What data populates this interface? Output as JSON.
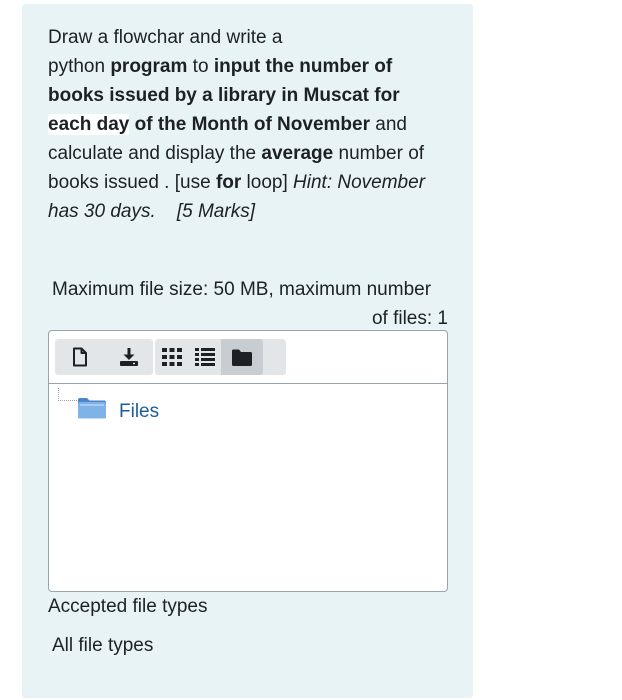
{
  "question": {
    "line1": {
      "t1": "Draw a flowchar and write a"
    },
    "line2": {
      "t1": "python ",
      "b1": "program",
      "t2": " to ",
      "b2": "input the number of"
    },
    "line3": {
      "b1": "books issued by a library in Muscat  for"
    },
    "line4": {
      "b1": "each day",
      "b2": " of the Month of November",
      "t1": " and"
    },
    "line5": {
      "t1": "calculate and display the ",
      "b1": "average",
      "t2": " number of"
    },
    "line6": {
      "t1": "books issued . [use ",
      "b1": "for",
      "t2": " loop] ",
      "i1": "Hint: November"
    },
    "line7": {
      "i1": "has 30 days.    [5 Marks]"
    }
  },
  "file_limits": {
    "line1": "Maximum file size: 50 MB, maximum number",
    "line2": "of files: 1"
  },
  "filemanager": {
    "toolbar": {
      "add_file_icon": "file-icon",
      "download_icon": "download-icon",
      "icons_view_icon": "grid-icon",
      "list_view_icon": "list-icon",
      "tree_view_icon": "folder-icon"
    },
    "folder_label": "Files",
    "folder_color": "#5b9bd5"
  },
  "accepted": {
    "label": "Accepted file types",
    "value": "All file types"
  }
}
